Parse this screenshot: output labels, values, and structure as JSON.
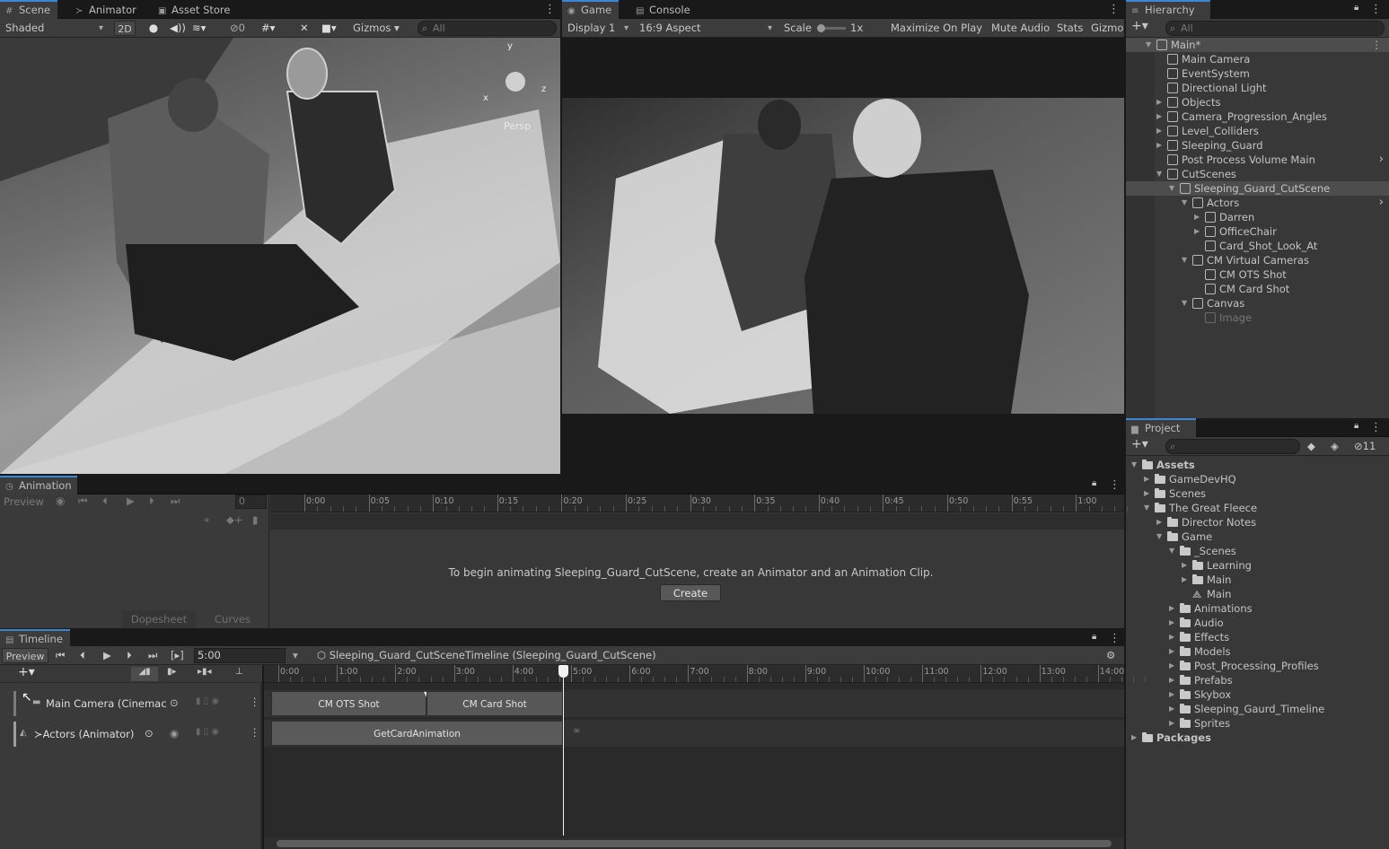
{
  "scene": {
    "tabs": [
      {
        "label": "Scene",
        "icon": "grid-icon",
        "active": true
      },
      {
        "label": "Animator",
        "icon": "animator-icon",
        "active": false
      },
      {
        "label": "Asset Store",
        "icon": "store-icon",
        "active": false
      }
    ],
    "shading": "Shaded",
    "btn_2d": "2D",
    "fx_count": "0",
    "gizmos": "Gizmos",
    "search_placeholder": "All",
    "persp_label": "Persp",
    "axes": {
      "x": "x",
      "y": "y",
      "z": "z"
    }
  },
  "game": {
    "tabs": [
      {
        "label": "Game",
        "icon": "gamepad-icon",
        "active": true
      },
      {
        "label": "Console",
        "icon": "console-icon",
        "active": false
      }
    ],
    "display": "Display 1",
    "aspect": "16:9 Aspect",
    "scale_label": "Scale",
    "scale_value": "1x",
    "maximize": "Maximize On Play",
    "mute": "Mute Audio",
    "stats": "Stats",
    "gizmos": "Gizmo"
  },
  "hierarchy": {
    "title": "Hierarchy",
    "search_placeholder": "All",
    "items": [
      {
        "label": "Main*",
        "depth": 0,
        "arrow": "down",
        "icon": "unity-scene-icon",
        "selected": true
      },
      {
        "label": "Main Camera",
        "depth": 1,
        "arrow": "",
        "icon": "cube-icon"
      },
      {
        "label": "EventSystem",
        "depth": 1,
        "arrow": "",
        "icon": "cube-icon"
      },
      {
        "label": "Directional Light",
        "depth": 1,
        "arrow": "",
        "icon": "cube-icon"
      },
      {
        "label": "Objects",
        "depth": 1,
        "arrow": "right",
        "icon": "cube-icon"
      },
      {
        "label": "Camera_Progression_Angles",
        "depth": 1,
        "arrow": "right",
        "icon": "cube-icon"
      },
      {
        "label": "Level_Colliders",
        "depth": 1,
        "arrow": "right",
        "icon": "cube-icon"
      },
      {
        "label": "Sleeping_Guard",
        "depth": 1,
        "arrow": "right",
        "icon": "prefab-icon"
      },
      {
        "label": "Post Process Volume Main",
        "depth": 1,
        "arrow": "",
        "icon": "cube-icon",
        "chevron": true
      },
      {
        "label": "CutScenes",
        "depth": 1,
        "arrow": "down",
        "icon": "cube-icon"
      },
      {
        "label": "Sleeping_Guard_CutScene",
        "depth": 2,
        "arrow": "down",
        "icon": "cube-icon",
        "selected": true
      },
      {
        "label": "Actors",
        "depth": 3,
        "arrow": "down",
        "icon": "prefab-icon",
        "chevron": true
      },
      {
        "label": "Darren",
        "depth": 4,
        "arrow": "right",
        "icon": "cube-icon"
      },
      {
        "label": "OfficeChair",
        "depth": 4,
        "arrow": "right",
        "icon": "cube-icon"
      },
      {
        "label": "Card_Shot_Look_At",
        "depth": 4,
        "arrow": "",
        "icon": "cube-icon"
      },
      {
        "label": "CM Virtual Cameras",
        "depth": 3,
        "arrow": "down",
        "icon": "cube-icon"
      },
      {
        "label": "CM OTS Shot",
        "depth": 4,
        "arrow": "",
        "icon": "cube-icon"
      },
      {
        "label": "CM Card Shot",
        "depth": 4,
        "arrow": "",
        "icon": "cube-icon"
      },
      {
        "label": "Canvas",
        "depth": 3,
        "arrow": "down",
        "icon": "cube-icon"
      },
      {
        "label": "Image",
        "depth": 4,
        "arrow": "",
        "icon": "cube-icon",
        "dim": true
      }
    ]
  },
  "project": {
    "title": "Project",
    "badge": "11",
    "items": [
      {
        "label": "Assets",
        "depth": 0,
        "arrow": "down",
        "bold": true
      },
      {
        "label": "GameDevHQ",
        "depth": 1,
        "arrow": "right"
      },
      {
        "label": "Scenes",
        "depth": 1,
        "arrow": "right"
      },
      {
        "label": "The Great Fleece",
        "depth": 1,
        "arrow": "down"
      },
      {
        "label": "Director Notes",
        "depth": 2,
        "arrow": "right"
      },
      {
        "label": "Game",
        "depth": 2,
        "arrow": "down"
      },
      {
        "label": "_Scenes",
        "depth": 3,
        "arrow": "down"
      },
      {
        "label": "Learning",
        "depth": 4,
        "arrow": "right"
      },
      {
        "label": "Main",
        "depth": 4,
        "arrow": "right"
      },
      {
        "label": "Main",
        "depth": 4,
        "arrow": "",
        "scene": true
      },
      {
        "label": "Animations",
        "depth": 3,
        "arrow": "right"
      },
      {
        "label": "Audio",
        "depth": 3,
        "arrow": "right"
      },
      {
        "label": "Effects",
        "depth": 3,
        "arrow": "right"
      },
      {
        "label": "Models",
        "depth": 3,
        "arrow": "right"
      },
      {
        "label": "Post_Processing_Profiles",
        "depth": 3,
        "arrow": "right"
      },
      {
        "label": "Prefabs",
        "depth": 3,
        "arrow": "right"
      },
      {
        "label": "Skybox",
        "depth": 3,
        "arrow": "right"
      },
      {
        "label": "Sleeping_Gaurd_Timeline",
        "depth": 3,
        "arrow": "right"
      },
      {
        "label": "Sprites",
        "depth": 3,
        "arrow": "right"
      },
      {
        "label": "Packages",
        "depth": 0,
        "arrow": "right",
        "bold": true
      }
    ]
  },
  "animation": {
    "title": "Animation",
    "preview": "Preview",
    "frame": "0",
    "ticks": [
      "0:00",
      "0:05",
      "0:10",
      "0:15",
      "0:20",
      "0:25",
      "0:30",
      "0:35",
      "0:40",
      "0:45",
      "0:50",
      "0:55",
      "1:00"
    ],
    "message": "To begin animating Sleeping_Guard_CutScene, create an Animator and an Animation Clip.",
    "create": "Create",
    "dopesheet": "Dopesheet",
    "curves": "Curves"
  },
  "timeline": {
    "title": "Timeline",
    "preview": "Preview",
    "time": "5:00",
    "asset": "Sleeping_Guard_CutSceneTimeline (Sleeping_Guard_CutScene)",
    "ticks": [
      "0:00",
      "1:00",
      "2:00",
      "3:00",
      "4:00",
      "5:00",
      "6:00",
      "7:00",
      "8:00",
      "9:00",
      "10:00",
      "11:00",
      "12:00",
      "13:00",
      "14:00"
    ],
    "tracks": [
      {
        "label": "Main Camera (Cinemac",
        "icon": "camera-icon"
      },
      {
        "label": "Actors (Animator)",
        "icon": "animator-icon"
      }
    ],
    "clips": {
      "ots": "CM OTS Shot",
      "card": "CM Card Shot",
      "anim": "GetCardAnimation"
    }
  }
}
